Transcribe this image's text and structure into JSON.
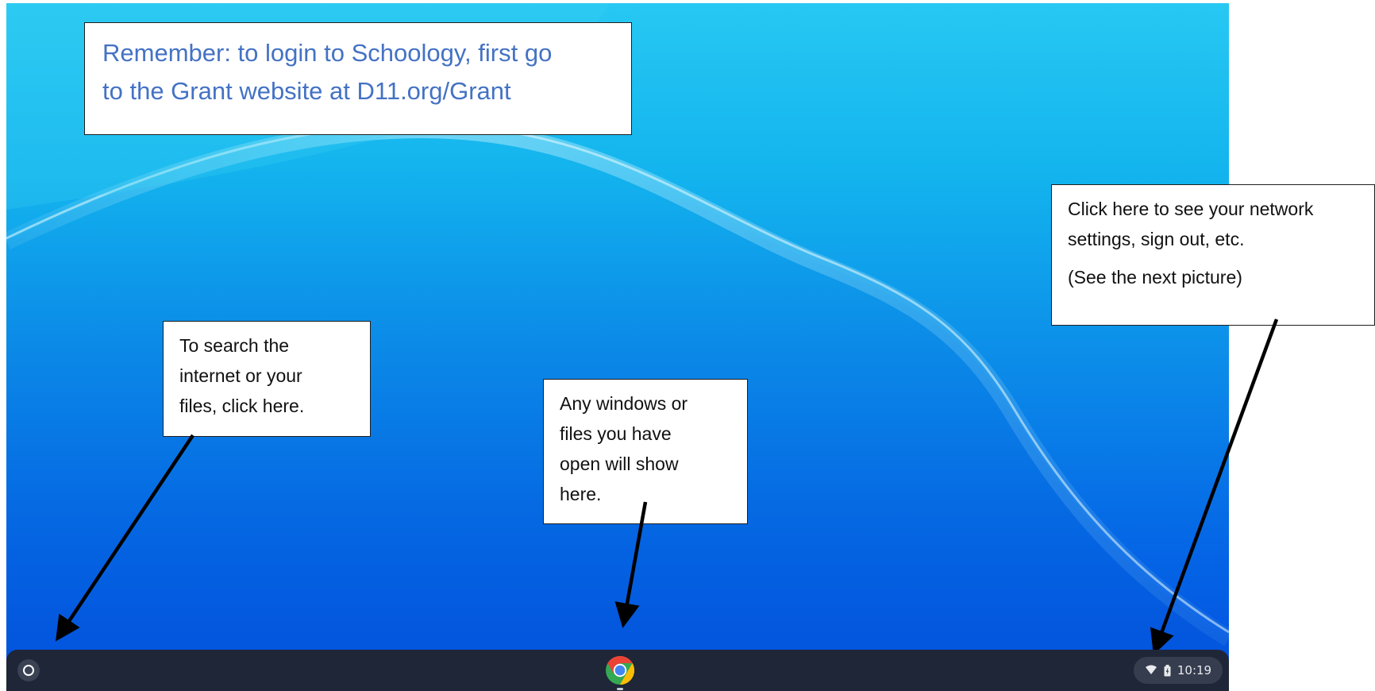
{
  "callouts": {
    "schoology": {
      "line1": "Remember:  to login to Schoology, first go",
      "line2": "to the Grant website at D11.org/Grant"
    },
    "search": {
      "line1": "To search the",
      "line2": "internet or your",
      "line3": "files, click here."
    },
    "windows": {
      "line1": "Any windows or",
      "line2": "files you have",
      "line3": "open will show",
      "line4": "here."
    },
    "status": {
      "line1": "Click here to see your network",
      "line2": "settings, sign out, etc.",
      "line3": "(See the next picture)"
    }
  },
  "shelf": {
    "launcher_icon": "launcher-circle-icon",
    "pinned_apps": [
      {
        "icon": "chrome-icon",
        "open": true
      }
    ],
    "status_area": {
      "wifi_icon": "wifi-icon",
      "battery_icon": "battery-icon",
      "clock": "10:19"
    }
  },
  "colors": {
    "callout_title": "#4472c4",
    "shelf_background": "#1f2638",
    "wallpaper_top": "#27c8f2",
    "wallpaper_bottom": "#0250e0",
    "arrow": "#000000"
  }
}
